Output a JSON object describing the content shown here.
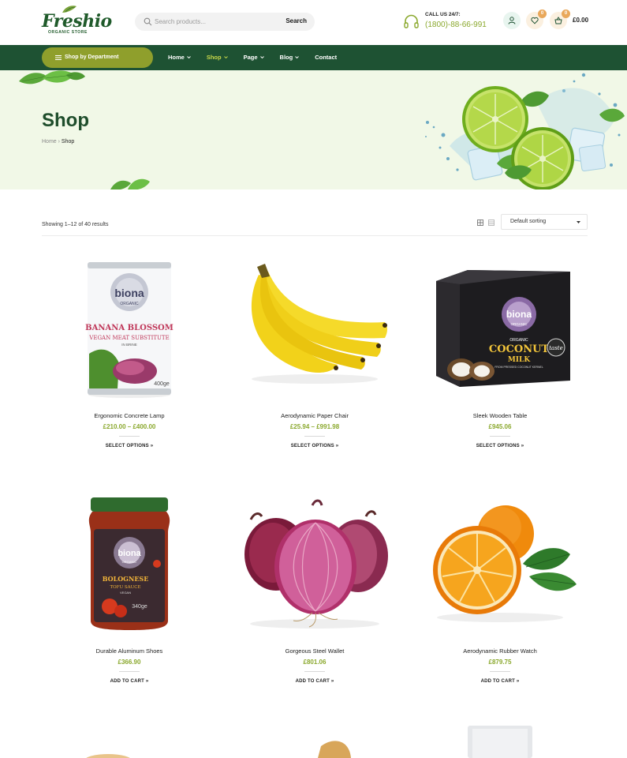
{
  "brand": {
    "name": "Freshio",
    "tagline": "ORGANIC STORE"
  },
  "search": {
    "placeholder": "Search products...",
    "button_label": "Search"
  },
  "contact": {
    "label": "CALL US 24/7:",
    "phone": "(1800)-88-66-991"
  },
  "account": {
    "wishlist_count": "0",
    "cart_count": "0",
    "cart_total": "£0.00"
  },
  "nav": {
    "department_label": "Shop by Department",
    "items": [
      {
        "label": "Home",
        "has_dropdown": true,
        "active": false
      },
      {
        "label": "Shop",
        "has_dropdown": true,
        "active": true
      },
      {
        "label": "Page",
        "has_dropdown": true,
        "active": false
      },
      {
        "label": "Blog",
        "has_dropdown": true,
        "active": false
      },
      {
        "label": "Contact",
        "has_dropdown": false,
        "active": false
      }
    ]
  },
  "hero": {
    "title": "Shop",
    "breadcrumb": [
      {
        "label": "Home"
      },
      {
        "label": "Shop"
      }
    ]
  },
  "toolbar": {
    "result_count": "Showing 1–12 of 40 results",
    "sort_selected": "Default sorting"
  },
  "products": [
    {
      "name": "Ergonomic Concrete Lamp",
      "price": "£210.00 – £400.00",
      "cta": "SELECT OPTIONS »",
      "image": "banana-blossom-can",
      "can_brand": "biona",
      "can_sub": "ORGANIC",
      "can_title": "BANANA BLOSSOM",
      "can_sub2": "VEGAN MEAT SUBSTITUTE",
      "can_sub3": "IN BRINE",
      "can_weight": "400ge"
    },
    {
      "name": "Aerodynamic Paper Chair",
      "price": "£25.94 – £991.98",
      "cta": "SELECT OPTIONS »",
      "image": "bananas"
    },
    {
      "name": "Sleek Wooden Table",
      "price": "£945.06",
      "cta": "SELECT OPTIONS »",
      "image": "coconut-milk-pack",
      "pack_brand": "biona",
      "pack_sub": "ORGANIC",
      "pack_line1": "ORGANIC",
      "pack_title": "COCONUT",
      "pack_title2": "MILK",
      "pack_note": "FROM PRESSED COCONUT KERNEL",
      "pack_badge": "taste"
    },
    {
      "name": "Durable Aluminum Shoes",
      "price": "£366.90",
      "cta": "ADD TO CART »",
      "image": "bolognese-jar",
      "jar_brand": "biona",
      "jar_sub": "ORGANIC",
      "jar_title": "BOLOGNESE",
      "jar_sub2": "TOFU SAUCE",
      "jar_sub3": "VEGAN",
      "jar_weight": "340ge"
    },
    {
      "name": "Gorgeous Steel Wallet",
      "price": "£801.06",
      "cta": "ADD TO CART »",
      "image": "red-onions"
    },
    {
      "name": "Aerodynamic Rubber Watch",
      "price": "£879.75",
      "cta": "ADD TO CART »",
      "image": "oranges"
    }
  ],
  "colors": {
    "primary_green": "#1e5233",
    "accent_olive": "#8f9f2c",
    "price_green": "#8aa82d",
    "hero_bg": "#f1f8e7",
    "badge": "#e9a85b"
  }
}
